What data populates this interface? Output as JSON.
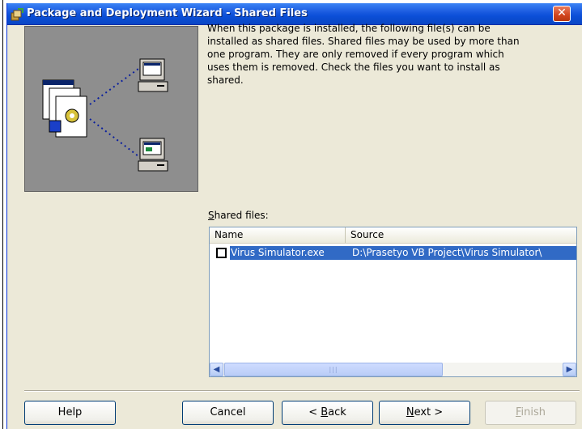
{
  "window": {
    "title": "Package and Deployment Wizard - Shared Files",
    "close_glyph": "✕"
  },
  "description": "When this package is installed, the following file(s) can be\ninstalled as shared files. Shared files may be used by more than\none program. They are only removed if every program which\nuses them is removed. Check the files you want to install as\nshared.",
  "shared_files": {
    "label_access_key": "S",
    "label_rest": "hared files:",
    "columns": [
      "Name",
      "Source"
    ],
    "rows": [
      {
        "name": "Virus Simulator.exe",
        "source": "D:\\Prasetyo VB Project\\Virus Simulator\\",
        "checked": false,
        "selected": true
      }
    ],
    "scroll": {
      "left": "◀",
      "right": "▶",
      "thumb_grip": "|||"
    }
  },
  "buttons": {
    "help": "Help",
    "cancel": "Cancel",
    "back_prefix": "< ",
    "back_key": "B",
    "back_rest": "ack",
    "next_key": "N",
    "next_rest": "ext >",
    "finish_key": "F",
    "finish_rest": "inish"
  },
  "colors": {
    "title_bar": "#0b4fd8",
    "selection": "#316ac5",
    "dialog_bg": "#ece9d8"
  },
  "icons": [
    "app-icon",
    "close-icon",
    "computer-icon",
    "document-icon"
  ]
}
